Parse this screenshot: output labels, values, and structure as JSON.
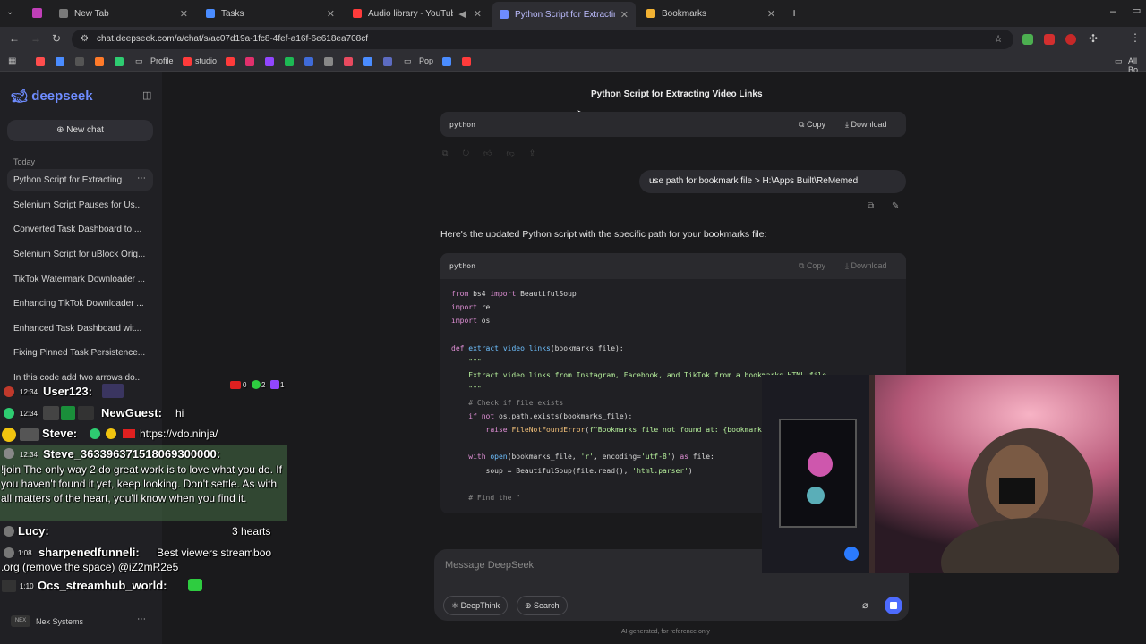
{
  "browser": {
    "tabs": [
      {
        "title": "New Tab",
        "favicon_color": "#7a7a7a"
      },
      {
        "title": "Tasks",
        "favicon_color": "#4a8cff"
      },
      {
        "title": "Audio library - YouTube Stu",
        "favicon_color": "#ff3b3b"
      },
      {
        "title": "Python Script for Extracting Vid",
        "favicon_color": "#6e8cff"
      },
      {
        "title": "Bookmarks",
        "favicon_color": "#f2b233"
      }
    ],
    "new_tab_label": "+",
    "url": "chat.deepseek.com/a/chat/s/ac07d19a-1fc8-4fef-a16f-6e618ea708cf",
    "bookmarks": [
      {
        "label": "Profile",
        "kind": "folder"
      },
      {
        "label": "studio",
        "kind": "link"
      },
      {
        "label": "Pop",
        "kind": "folder"
      }
    ],
    "all_bookmarks_label": "All Bo"
  },
  "sidebar": {
    "logo": "deepseek",
    "new_chat_label": "New chat",
    "section_label": "Today",
    "items": [
      "Python Script for Extracting",
      "Selenium Script Pauses for Us...",
      "Converted Task Dashboard to ...",
      "Selenium Script for uBlock Orig...",
      "TikTok Watermark Downloader ...",
      "Enhancing TikTok Downloader ...",
      "Enhanced Task Dashboard wit...",
      "Fixing Pinned Task Persistence...",
      "In this code add two arrows do..."
    ],
    "footer_label": "Nex Systems"
  },
  "chat": {
    "title": "Python Script for Extracting Video Links",
    "code_lang": "python",
    "copy_label": "Copy",
    "download_label": "Download",
    "user_message": "use path for bookmark file > H:\\Apps Built\\ReMemed",
    "assistant_intro": "Here's the updated Python script with the specific path for your bookmarks file:",
    "code_lines": [
      {
        "html": "<span class='kw'>from</span> bs4 <span class='kw'>import</span> BeautifulSoup"
      },
      {
        "html": "<span class='kw'>import</span> re"
      },
      {
        "html": "<span class='kw'>import</span> os"
      },
      {
        "html": ""
      },
      {
        "html": "<span class='kw'>def</span> <span class='fn'>extract_video_links</span>(bookmarks_file):"
      },
      {
        "html": "    <span class='str'>\"\"\"</span>"
      },
      {
        "html": "    <span class='str'>Extract video links from Instagram, Facebook, and TikTok from a bookmarks HTML file</span>"
      },
      {
        "html": "    <span class='str'>\"\"\"</span>"
      },
      {
        "html": "    <span class='cm'># Check if file exists</span>"
      },
      {
        "html": "    <span class='kw'>if not</span> os.path.exists(bookmarks_file):"
      },
      {
        "html": "        <span class='kw'>raise</span> <span class='err'>FileNotFoundError</span>(<span class='str'>f\"Bookmarks file not found at: {bookmarks_file}\"</span>)"
      },
      {
        "html": ""
      },
      {
        "html": "    <span class='kw'>with</span> <span class='fn'>open</span>(bookmarks_file, <span class='str'>'r'</span>, encoding=<span class='str'>'utf-8'</span>) <span class='kw'>as</span> file:"
      },
      {
        "html": "        soup = BeautifulSoup(file.read(), <span class='str'>'html.parser'</span>)"
      },
      {
        "html": ""
      },
      {
        "html": "    <span class='cm'># Find the \"</span>"
      }
    ],
    "composer_placeholder": "Message DeepSeek",
    "deepthink_label": "DeepThink",
    "search_label": "Search",
    "footer_note": "AI-generated, for reference only"
  },
  "overlay": {
    "badges": [
      "0",
      "2",
      "1"
    ],
    "messages": [
      {
        "time": "12:34",
        "name": "User123:",
        "text": ""
      },
      {
        "time": "12:34",
        "name": "NewGuest:",
        "text": "hi"
      },
      {
        "time": "",
        "name": "Steve:",
        "text": "https://vdo.ninja/"
      },
      {
        "time": "12:34",
        "name": "Steve_3633963715180693000​00:",
        "text": "!join The only way 2 do great work is to love what you do. If you haven't found it yet, keep looking. Don't settle. As with all matters of the heart, you'll know when you find it."
      },
      {
        "time": "",
        "name": "Lucy:",
        "text": "3 hearts"
      },
      {
        "time": "1:08",
        "name": "sharpenedfunneli:",
        "text": "Best viewers streamboo .org (remove the space) @iZ2mR2e5"
      },
      {
        "time": "1:10",
        "name": "Ocs_streamhub_world:",
        "text": ""
      }
    ]
  }
}
